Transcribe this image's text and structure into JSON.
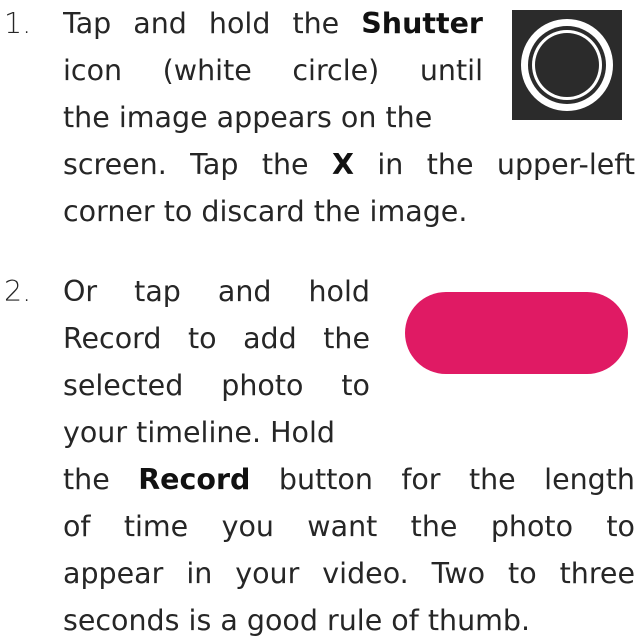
{
  "colors": {
    "text": "#262626",
    "shutter_background": "#2b2b2b",
    "shutter_ring": "#ffffff",
    "record_button": "#e01a64"
  },
  "steps": [
    {
      "number": "1.",
      "icon": "shutter-icon",
      "lines_beside_icon": [
        {
          "parts": [
            {
              "text": "Tap and hold the "
            },
            {
              "text": "Shutter",
              "bold": true
            }
          ]
        },
        {
          "parts": [
            {
              "text": "icon (white circle) until"
            }
          ]
        },
        {
          "parts": [
            {
              "text": "the image appears on the"
            }
          ]
        }
      ],
      "lines_below_icon": [
        {
          "parts": [
            {
              "text": "screen. Tap the "
            },
            {
              "text": "X",
              "bold": true
            },
            {
              "text": " in the upper-left"
            }
          ]
        },
        {
          "parts": [
            {
              "text": "corner to discard the image."
            }
          ]
        }
      ]
    },
    {
      "number": "2.",
      "icon": "record-button",
      "lines_beside_icon": [
        {
          "parts": [
            {
              "text": "Or tap and hold"
            }
          ]
        },
        {
          "parts": [
            {
              "text": "Record to add the"
            }
          ]
        },
        {
          "parts": [
            {
              "text": "selected photo to"
            }
          ]
        },
        {
          "parts": [
            {
              "text": "your timeline. Hold"
            }
          ]
        }
      ],
      "lines_below_icon": [
        {
          "parts": [
            {
              "text": "the "
            },
            {
              "text": "Record",
              "bold": true
            },
            {
              "text": " button for the length"
            }
          ]
        },
        {
          "parts": [
            {
              "text": "of time you want the photo to"
            }
          ]
        },
        {
          "parts": [
            {
              "text": "appear in your video. Two to three"
            }
          ]
        },
        {
          "parts": [
            {
              "text": "seconds is a good rule of thumb."
            }
          ]
        }
      ]
    }
  ]
}
